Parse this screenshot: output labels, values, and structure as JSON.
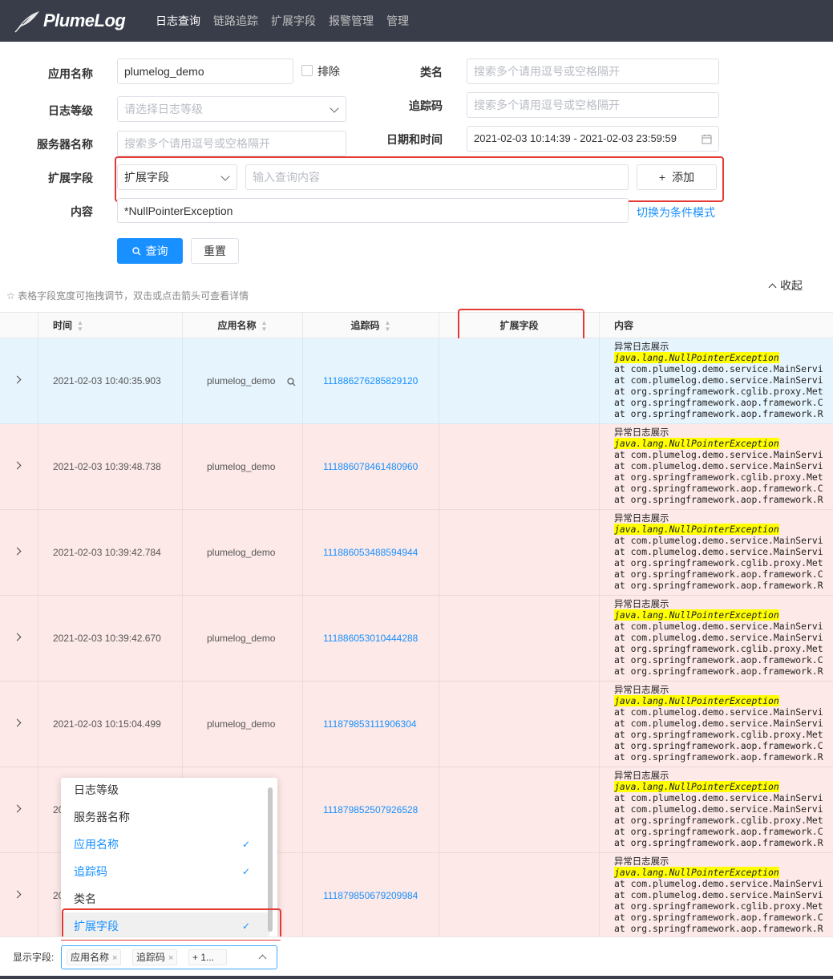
{
  "app": {
    "logo_text": "PlumeLog"
  },
  "nav": [
    "日志查询",
    "链路追踪",
    "扩展字段",
    "报警管理",
    "管理"
  ],
  "form": {
    "app_name_label": "应用名称",
    "app_name_value": "plumelog_demo",
    "exclude_label": "排除",
    "class_label": "类名",
    "class_placeholder": "搜索多个请用逗号或空格隔开",
    "level_label": "日志等级",
    "level_placeholder": "请选择日志等级",
    "trace_label": "追踪码",
    "trace_placeholder": "搜索多个请用逗号或空格隔开",
    "server_label": "服务器名称",
    "server_placeholder": "搜索多个请用逗号或空格隔开",
    "datetime_label": "日期和时间",
    "datetime_value": "2021-02-03 10:14:39 - 2021-02-03 23:59:59",
    "ext_label": "扩展字段",
    "ext_select_value": "扩展字段",
    "ext_input_placeholder": "输入查询内容",
    "add_button": "添加",
    "content_label": "内容",
    "content_value": "*NullPointerException",
    "switch_mode_link": "切换为条件模式",
    "query_button": "查询",
    "reset_button": "重置"
  },
  "table": {
    "hint": "表格字段宽度可拖拽调节，双击或点击箭头可查看详情",
    "collapse_label": "收起",
    "columns": [
      "时间",
      "应用名称",
      "追踪码",
      "扩展字段",
      "内容"
    ],
    "content_title": "异常日志展示",
    "content_exception": "java.lang.NullPointerException",
    "content_lines": [
      "at com.plumelog.demo.service.MainServi",
      "at com.plumelog.demo.service.MainServi",
      "at org.springframework.cglib.proxy.Met",
      "at org.springframework.aop.framework.C",
      "at org.springframework.aop.framework.R"
    ],
    "rows": [
      {
        "time": "2021-02-03 10:40:35.903",
        "app": "plumelog_demo",
        "trace": "111886276285829120"
      },
      {
        "time": "2021-02-03 10:39:48.738",
        "app": "plumelog_demo",
        "trace": "111886078461480960"
      },
      {
        "time": "2021-02-03 10:39:42.784",
        "app": "plumelog_demo",
        "trace": "111886053488594944"
      },
      {
        "time": "2021-02-03 10:39:42.670",
        "app": "plumelog_demo",
        "trace": "111886053010444288"
      },
      {
        "time": "2021-02-03 10:15:04.499",
        "app": "plumelog_demo",
        "trace": "111879853111906304"
      },
      {
        "time": "20",
        "app": "",
        "trace": "111879852507926528"
      },
      {
        "time": "20",
        "app": "",
        "trace": "111879850679209984"
      }
    ]
  },
  "dropdown": {
    "items": [
      {
        "label": "日志等级",
        "checked": false
      },
      {
        "label": "服务器名称",
        "checked": false
      },
      {
        "label": "应用名称",
        "checked": true
      },
      {
        "label": "追踪码",
        "checked": true
      },
      {
        "label": "类名",
        "checked": false
      },
      {
        "label": "扩展字段",
        "checked": true
      }
    ],
    "check_glyph": "✓"
  },
  "bottom": {
    "label": "显示字段:",
    "tags": [
      "应用名称",
      "追踪码",
      "+ 1..."
    ],
    "remove_glyph": "×"
  },
  "colors": {
    "primary": "#1890ff",
    "error_row": "#fde9e7",
    "selected_row": "#e6f4fd",
    "highlight_box": "#e53935",
    "topbar": "#393d49"
  },
  "icons": {
    "logo": "feather-icon",
    "search": "search-icon",
    "calendar": "calendar-icon",
    "star": "star-icon"
  }
}
